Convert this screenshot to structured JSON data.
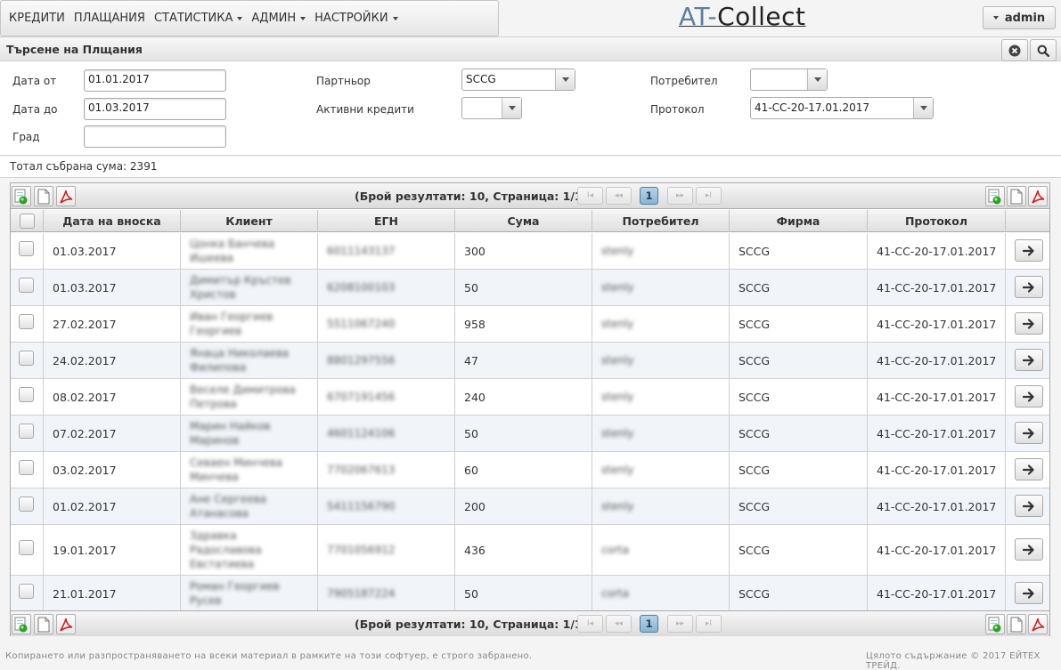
{
  "nav": {
    "items": [
      {
        "label": "КРЕДИТИ",
        "dropdown": false
      },
      {
        "label": "ПЛАЩАНИЯ",
        "dropdown": false
      },
      {
        "label": "СТАТИСТИКА",
        "dropdown": true
      },
      {
        "label": "АДМИН",
        "dropdown": true
      },
      {
        "label": "НАСТРОЙКИ",
        "dropdown": true
      }
    ],
    "logo_prefix": "AT-",
    "logo_suffix": "Collect",
    "user_label": "admin"
  },
  "search": {
    "title": "Търсене на Плщания",
    "date_from_label": "Дата от",
    "date_from": "01.01.2017",
    "date_to_label": "Дата до",
    "date_to": "01.03.2017",
    "city_label": "Град",
    "city": "",
    "partner_label": "Партньор",
    "partner": "SCCG",
    "active_credits_label": "Активни кредити",
    "active_credits": "",
    "user_label": "Потребител",
    "user": "",
    "protocol_label": "Протокол",
    "protocol": "41-CC-20-17.01.2017"
  },
  "total_text": "Тотал събрана сума: 2391",
  "grid": {
    "pager_info": "(Брой резултати: 10, Страница: 1/1)",
    "current_page": "1",
    "pager_buttons": {
      "first": "I◂",
      "prev": "◂◂",
      "next": "▸▸",
      "last": "▸I"
    },
    "columns": [
      "Дата на вноска",
      "Клиент",
      "ЕГН",
      "Сума",
      "Потребител",
      "Фирма",
      "Протокол"
    ],
    "rows": [
      {
        "date": "01.03.2017",
        "client": "Цонка Банчева Ишеева",
        "egn": "6011143137",
        "amount": "300",
        "user": "stenly",
        "firm": "SCCG",
        "protocol": "41-CC-20-17.01.2017"
      },
      {
        "date": "01.03.2017",
        "client": "Димитър Кръстев Христов",
        "egn": "6208100103",
        "amount": "50",
        "user": "stenly",
        "firm": "SCCG",
        "protocol": "41-CC-20-17.01.2017"
      },
      {
        "date": "27.02.2017",
        "client": "Иван Георгиев Георгиев",
        "egn": "5511067240",
        "amount": "958",
        "user": "stenly",
        "firm": "SCCG",
        "protocol": "41-CC-20-17.01.2017"
      },
      {
        "date": "24.02.2017",
        "client": "Янаца Николаева Филипова",
        "egn": "8801297556",
        "amount": "47",
        "user": "stenly",
        "firm": "SCCG",
        "protocol": "41-CC-20-17.01.2017"
      },
      {
        "date": "08.02.2017",
        "client": "Веселе Димитрова Петрова",
        "egn": "6707191456",
        "amount": "240",
        "user": "stenly",
        "firm": "SCCG",
        "protocol": "41-CC-20-17.01.2017"
      },
      {
        "date": "07.02.2017",
        "client": "Марин Найков Маринов",
        "egn": "4601124106",
        "amount": "50",
        "user": "stenly",
        "firm": "SCCG",
        "protocol": "41-CC-20-17.01.2017"
      },
      {
        "date": "03.02.2017",
        "client": "Севаен Минчева Минчева",
        "egn": "7702067613",
        "amount": "60",
        "user": "stenly",
        "firm": "SCCG",
        "protocol": "41-CC-20-17.01.2017"
      },
      {
        "date": "01.02.2017",
        "client": "Ане Сергеева Атанасова",
        "egn": "5411156790",
        "amount": "200",
        "user": "stenly",
        "firm": "SCCG",
        "protocol": "41-CC-20-17.01.2017"
      },
      {
        "date": "19.01.2017",
        "client": "Здравка Радославова Евстатиева",
        "egn": "7701056912",
        "amount": "436",
        "user": "corta",
        "firm": "SCCG",
        "protocol": "41-CC-20-17.01.2017"
      },
      {
        "date": "21.01.2017",
        "client": "Роман Георгиев Русев",
        "egn": "7905187224",
        "amount": "50",
        "user": "corta",
        "firm": "SCCG",
        "protocol": "41-CC-20-17.01.2017"
      }
    ]
  },
  "footer": {
    "left": "Копирането или разпространяването на всеки материал в рамките на този софтуер, е строго забранено.",
    "right": "Цялото съдържание © 2017 ЕЙТЕХ ТРЕЙД."
  },
  "icons": {
    "close": "close-icon",
    "search": "search-icon",
    "excel": "excel-export-icon",
    "csv": "csv-export-icon",
    "pdf": "pdf-export-icon",
    "arrow": "arrow-right-icon"
  },
  "colors": {
    "accent": "#8ab4d2",
    "logo_blue": "#5a7fa6"
  }
}
